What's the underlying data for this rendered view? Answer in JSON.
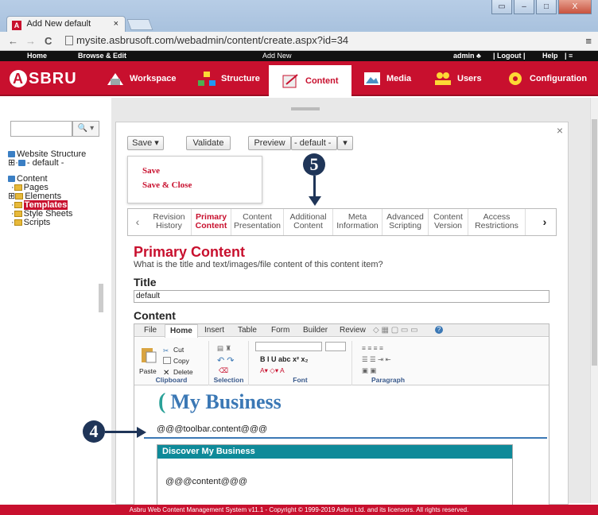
{
  "browser": {
    "tab_title": "Add New default",
    "tab_close": "×",
    "url": "mysite.asbrusoft.com/webadmin/content/create.aspx?id=34",
    "nav_back": "←",
    "nav_forward": "→",
    "nav_reload": "C",
    "menu": "≡",
    "window_buttons": [
      "▭",
      "–",
      "□",
      "X"
    ]
  },
  "topbar": {
    "home": "Home",
    "browse_edit": "Browse & Edit",
    "add_new": "Add New",
    "user": "admin ♣",
    "logout": "| Logout |",
    "help": "Help",
    "menu": "| ≡"
  },
  "mainnav": {
    "logo": "SBRU",
    "logo_letter": "A",
    "items": [
      "Workspace",
      "Structure",
      "Content",
      "Media",
      "Users",
      "Configuration"
    ],
    "active": "Content",
    "brand_color": "#c8102e"
  },
  "sidebar": {
    "search_button": "🔍 ▾",
    "tree": [
      "Website Structure",
      "- default -",
      "Content",
      "Pages",
      "Elements",
      "Templates",
      "Style Sheets",
      "Scripts"
    ],
    "tree_prefix": [
      "",
      "⊞·",
      "",
      "·",
      "⊞",
      "·",
      "·",
      "·"
    ],
    "selected": "Templates"
  },
  "dialog": {
    "close": "×",
    "save": "Save ▾",
    "validate": "Validate",
    "preview": "Preview",
    "preview_select": "- default -",
    "preview_select_arrow": "▾",
    "save_menu": [
      "Save",
      "Save & Close"
    ],
    "tabs": [
      [
        "Revision",
        "History"
      ],
      [
        "Primary",
        "Content"
      ],
      [
        "Content",
        "Presentation"
      ],
      [
        "Additional",
        "Content"
      ],
      [
        "Meta",
        "Information"
      ],
      [
        "Advanced",
        "Scripting"
      ],
      [
        "Content",
        "Version"
      ],
      [
        "Access",
        "Restrictions"
      ]
    ],
    "tab_prev": "‹",
    "tab_next": "›",
    "active_tab": "Primary Content",
    "heading": "Primary Content",
    "subheading": "What is the title and text/images/file content of this content item?",
    "title_label": "Title",
    "title_value": "default",
    "content_label": "Content"
  },
  "editor": {
    "tabs": [
      "File",
      "Home",
      "Insert",
      "Table",
      "Form",
      "Builder",
      "Review"
    ],
    "active_tab": "Home",
    "groups": [
      "Clipboard",
      "Selection",
      "Font",
      "Paragraph"
    ],
    "clipboard": {
      "paste": "Paste",
      "cut": "Cut",
      "copy": "Copy",
      "delete": "Delete"
    },
    "font_buttons": "B  I  U  abc  x²  x₂",
    "brand_text": "My Business",
    "brand_mark": "(",
    "toolbar_placeholder": "@@@toolbar.content@@@",
    "box_heading": "Discover My Business",
    "content_placeholder": "@@@content@@@"
  },
  "annotations": {
    "badge_4": "4",
    "badge_5": "5"
  },
  "footer": "Asbru Web Content Management System v11.1 - Copyright © 1999-2019 Asbru Ltd. and its licensors. All rights reserved."
}
